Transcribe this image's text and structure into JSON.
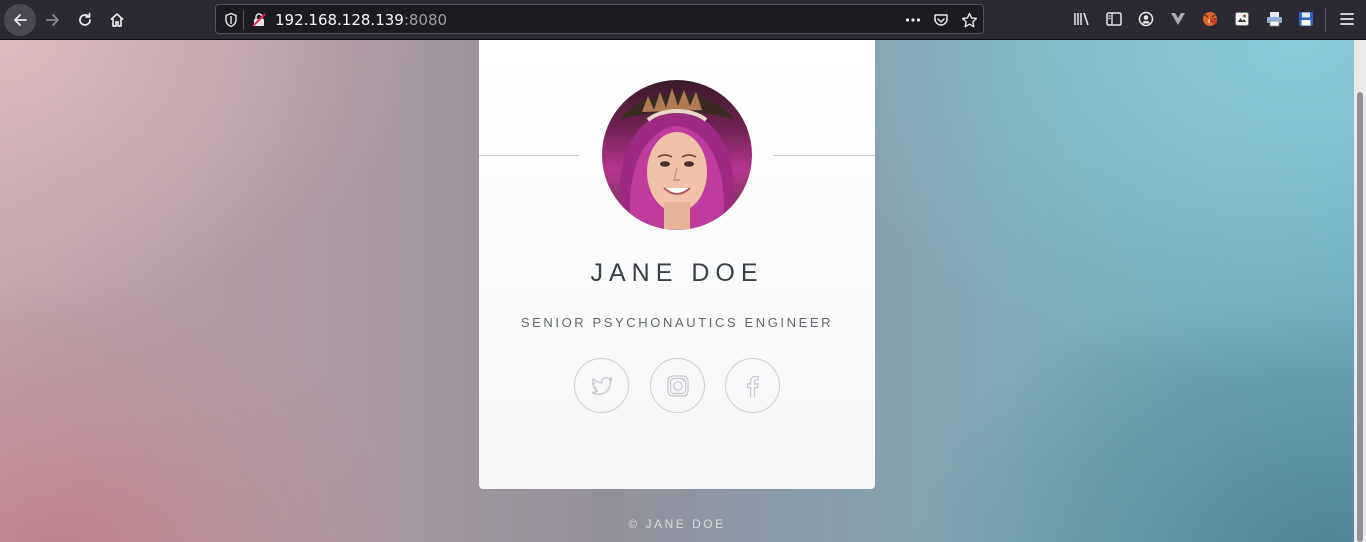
{
  "browser": {
    "url_host": "192.168.128.139",
    "url_port": ":8080",
    "icons": {
      "back": "arrow-left-icon",
      "forward": "arrow-right-icon",
      "reload": "reload-icon",
      "home": "home-icon",
      "tracking": "shield-icon",
      "insecure": "insecure-lock-icon",
      "page_actions": "more-icon",
      "pocket": "pocket-icon",
      "bookmark": "star-icon",
      "library": "library-icon",
      "sidebar": "sidebar-icon",
      "account": "account-icon",
      "vue_devtools": "vue-devtools-icon",
      "foxyproxy": "foxyproxy-icon",
      "extension_a": "extension-icon",
      "extension_b": "printer-icon",
      "extension_c": "floppy-disk-icon",
      "menu": "hamburger-menu-icon"
    }
  },
  "profile": {
    "name": "JANE DOE",
    "title": "SENIOR PSYCHONAUTICS ENGINEER",
    "social": [
      "twitter-icon",
      "instagram-icon",
      "facebook-icon"
    ]
  },
  "footer": {
    "copyright": "© JANE DOE"
  },
  "colors": {
    "toolbar_bg": "#2b2a33",
    "urlbar_bg": "#1c1b22",
    "card_bg": "#ffffff",
    "name_text": "#3c3f44",
    "social_stroke": "#cfd0d3"
  }
}
